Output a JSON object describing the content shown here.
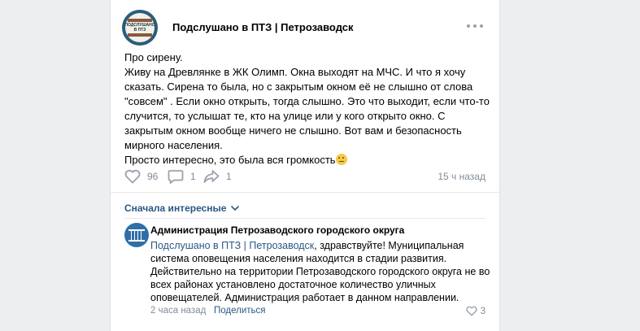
{
  "post": {
    "group_name": "Подслушано в ПТЗ | Петрозаводск",
    "avatar_text": "ПОДСЛУШАНО В ПТЗ",
    "text_lines": [
      "Про сирену.",
      "Живу на Древлянке в ЖК Олимп. Окна выходят на МЧС. И что я хочу сказать. Сирена то была, но с закрытым окном её не слышно от слова \"совсем\" . Если окно открыть, тогда слышно. Это что выходит, если что-то случится, то услышат те, кто на улице или у кого открыто окно. С закрытым окном вообще ничего не слышно. Вот вам и безопасность мирного населения."
    ],
    "last_line": "Просто интересно, это была вся громкость",
    "likes": "96",
    "comments": "1",
    "shares": "1",
    "time": "15 ч назад"
  },
  "comments_section": {
    "sort_label": "Сначала интересные"
  },
  "comment": {
    "author": "Администрация Петрозаводского городского округа",
    "mention": "Подслушано в ПТЗ | Петрозаводск",
    "text": ", здравствуйте! Муниципальная система оповещения населения находится в стадии развития. Действительно на территории Петрозаводского городского округа не во всех районах установлено достаточное количество уличных оповещателей. Администрация работает в данном направлении.",
    "time": "2 часа назад",
    "share_label": "Поделиться",
    "likes": "3"
  },
  "colors": {
    "link": "#2a5885",
    "secondary": "#818c99",
    "background": "#edeef0"
  },
  "icons": [
    "more-icon",
    "heart-icon",
    "comment-icon",
    "share-icon",
    "chevron-down-icon",
    "emoji-thinking-icon"
  ]
}
